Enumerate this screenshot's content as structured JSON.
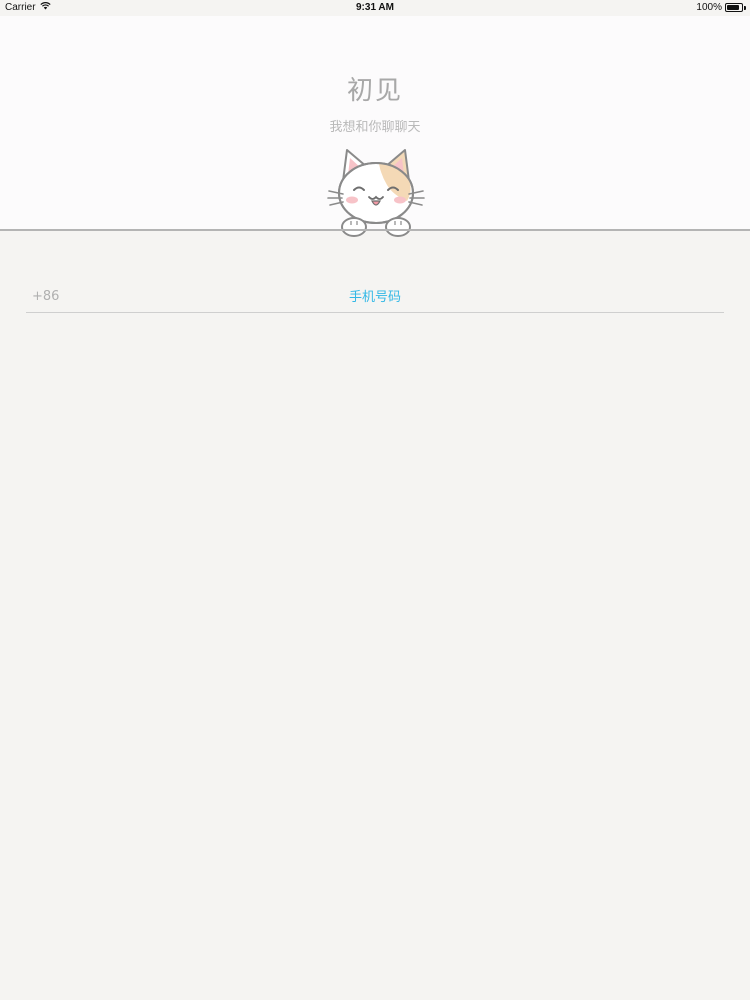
{
  "status_bar": {
    "carrier": "Carrier",
    "time": "9:31 AM",
    "battery": "100%",
    "battery_level": 1.0,
    "wifi_icon": "wifi-icon",
    "battery_icon": "battery-icon"
  },
  "header": {
    "title": "初见",
    "subtitle": "我想和你聊聊天",
    "mascot_icon": "cat-mascot-icon"
  },
  "form": {
    "country_code": "+86",
    "phone_placeholder": "手机号码",
    "phone_value": ""
  },
  "colors": {
    "header_bg": "#fcfbfc",
    "page_bg": "#f5f4f2",
    "accent": "#33b8e6",
    "divider": "#b4b4b4"
  }
}
